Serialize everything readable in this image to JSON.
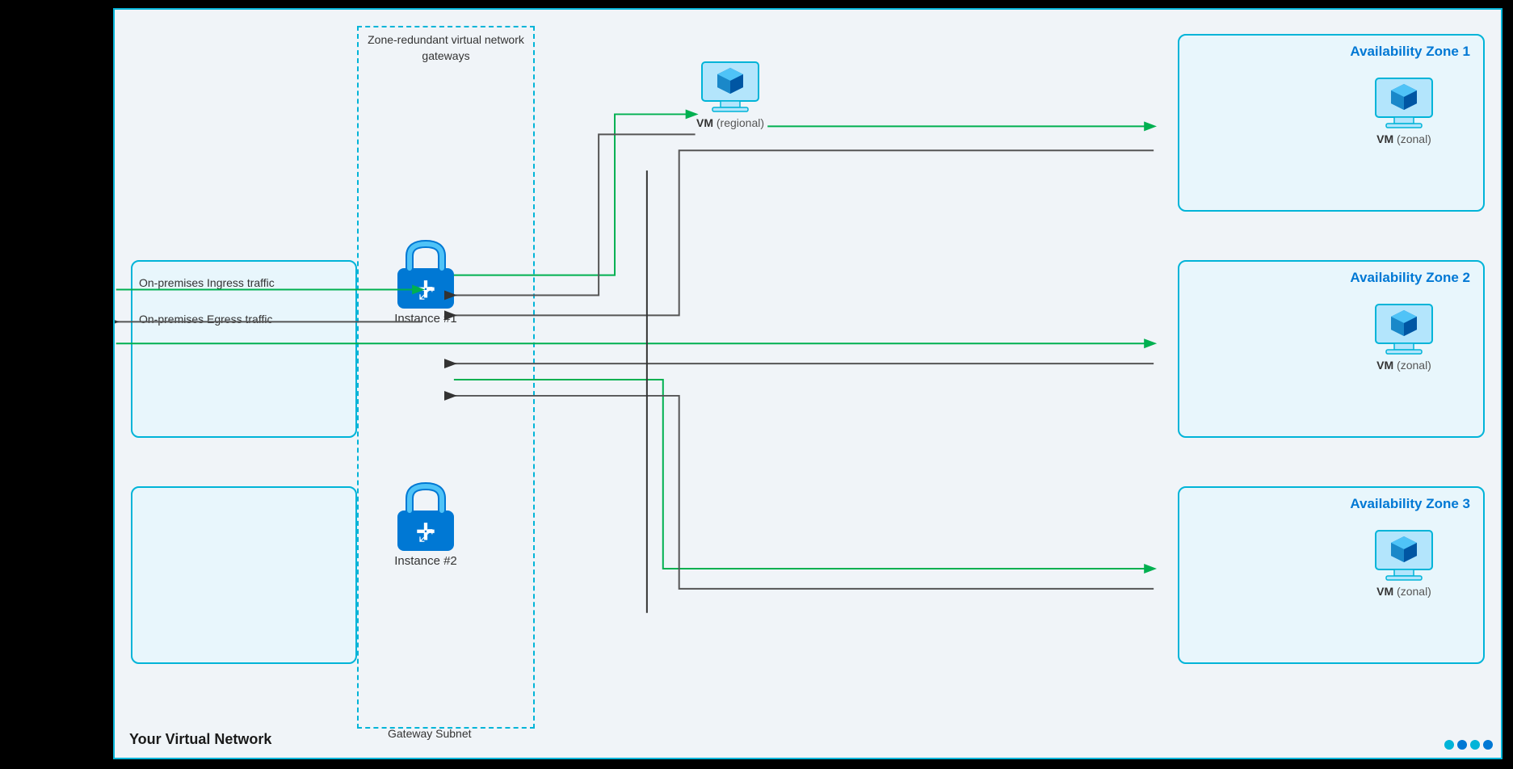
{
  "diagram": {
    "title": "Zone-redundant virtual network gateways",
    "gatewaySubnetLabel": "Gateway Subnet",
    "virtualNetworkLabel": "Your Virtual Network",
    "ingress": "On-premises Ingress traffic",
    "egress": "On-premises Egress traffic",
    "instance1Label": "Instance #1",
    "instance2Label": "Instance #2",
    "vm_regional_label": "VM",
    "vm_regional_sub": "(regional)",
    "vm_zonal_label": "VM",
    "vm_zonal_sub": "(zonal)",
    "az1Label": "Availability Zone 1",
    "az2Label": "Availability Zone 2",
    "az3Label": "Availability Zone 3",
    "colors": {
      "cyan": "#00b4d8",
      "blue": "#0078d4",
      "green": "#00b050",
      "darkgray": "#555555",
      "black": "#111111"
    }
  }
}
